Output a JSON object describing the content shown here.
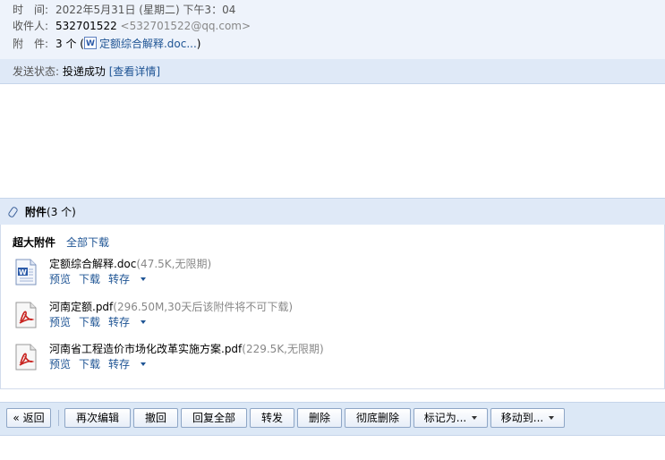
{
  "header": {
    "time_label": "时　间:",
    "time_value": "2022年5月31日 (星期二) 下午3：04",
    "to_label": "收件人:",
    "to_name": "532701522",
    "to_email": "<532701522@qq.com>",
    "att_label": "附　件:",
    "att_count": "3 个",
    "att_open": "(",
    "att_first": "定额综合解释.doc...",
    "att_close": ")",
    "icon": "word-doc-icon"
  },
  "status": {
    "label": "发送状态:",
    "value": "投递成功",
    "detail": "[查看详情]"
  },
  "attachments": {
    "title": "附件",
    "count": "(3 个)",
    "section": "超大附件",
    "download_all": "全部下载",
    "files": [
      {
        "name": "定额综合解释.doc",
        "info": "(47.5K,无限期)",
        "icon": "word-doc-icon",
        "preview": "预览",
        "download": "下载",
        "save": "转存"
      },
      {
        "name": "河南定额.pdf",
        "info": "(296.50M,30天后该附件将不可下载)",
        "icon": "pdf-icon",
        "preview": "预览",
        "download": "下载",
        "save": "转存"
      },
      {
        "name": "河南省工程造价市场化改革实施方案.pdf",
        "info": "(229.5K,无限期)",
        "icon": "pdf-icon",
        "preview": "预览",
        "download": "下载",
        "save": "转存"
      }
    ]
  },
  "toolbar": {
    "back": "« 返回",
    "reedit": "再次编辑",
    "recall": "撤回",
    "reply_all": "回复全部",
    "forward": "转发",
    "delete": "删除",
    "delete_forever": "彻底删除",
    "mark_as": "标记为...",
    "move_to": "移动到..."
  },
  "colors": {
    "link": "#1e5494",
    "panel": "#dfe9f7",
    "meta_bg": "#eef3fb"
  }
}
